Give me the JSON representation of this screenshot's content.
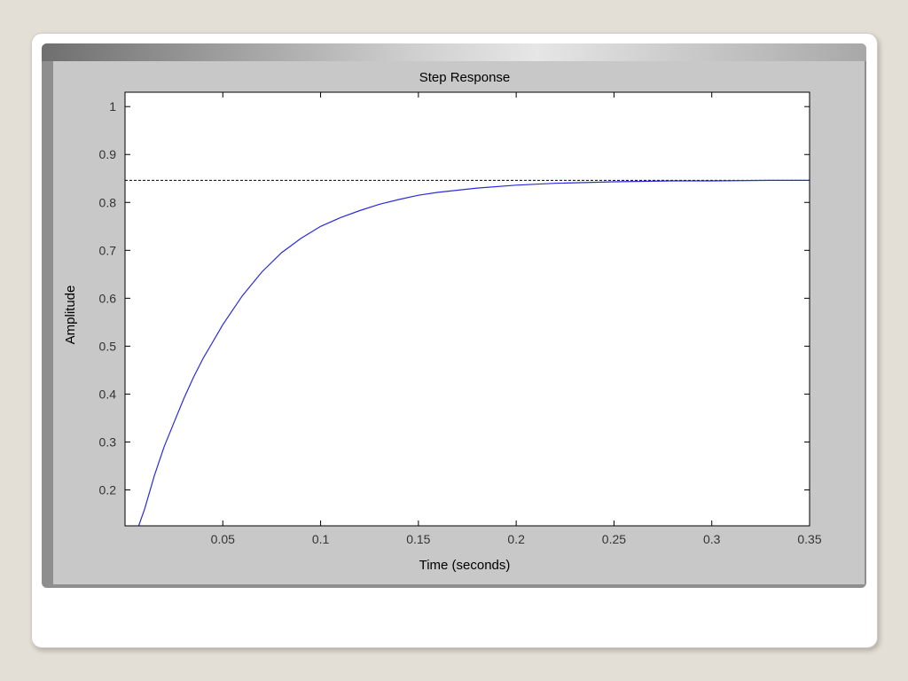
{
  "chart_data": {
    "type": "line",
    "title": "Step Response",
    "xlabel": "Time (seconds)",
    "ylabel": "Amplitude",
    "xlim": [
      0.0,
      0.35
    ],
    "ylim": [
      0.125,
      1.03
    ],
    "x_ticks": [
      0.05,
      0.1,
      0.15,
      0.2,
      0.25,
      0.3,
      0.35
    ],
    "x_tick_labels": [
      "0.05",
      "0.1",
      "0.15",
      "0.2",
      "0.25",
      "0.3",
      "0.35"
    ],
    "y_ticks": [
      0.2,
      0.3,
      0.4,
      0.5,
      0.6,
      0.7,
      0.8,
      0.9,
      1
    ],
    "y_tick_labels": [
      "0.2",
      "0.3",
      "0.4",
      "0.5",
      "0.6",
      "0.7",
      "0.8",
      "0.9",
      "1"
    ],
    "grid": false,
    "steady_state": 0.846,
    "series": [
      {
        "color": "#2a2ae0",
        "x": [
          0.007,
          0.01,
          0.015,
          0.02,
          0.025,
          0.03,
          0.035,
          0.04,
          0.045,
          0.05,
          0.06,
          0.07,
          0.08,
          0.09,
          0.1,
          0.11,
          0.12,
          0.13,
          0.14,
          0.15,
          0.16,
          0.18,
          0.2,
          0.22,
          0.25,
          0.28,
          0.3,
          0.33,
          0.35
        ],
        "y": [
          0.125,
          0.16,
          0.23,
          0.29,
          0.34,
          0.39,
          0.435,
          0.475,
          0.51,
          0.545,
          0.605,
          0.655,
          0.695,
          0.725,
          0.75,
          0.768,
          0.783,
          0.796,
          0.806,
          0.815,
          0.821,
          0.83,
          0.836,
          0.84,
          0.843,
          0.845,
          0.845,
          0.846,
          0.846
        ]
      }
    ]
  },
  "colors": {
    "curve": "#2a2ae0",
    "reference_line": "#000000",
    "axes_background": "#ffffff",
    "figure_background": "#c8c8c8"
  }
}
